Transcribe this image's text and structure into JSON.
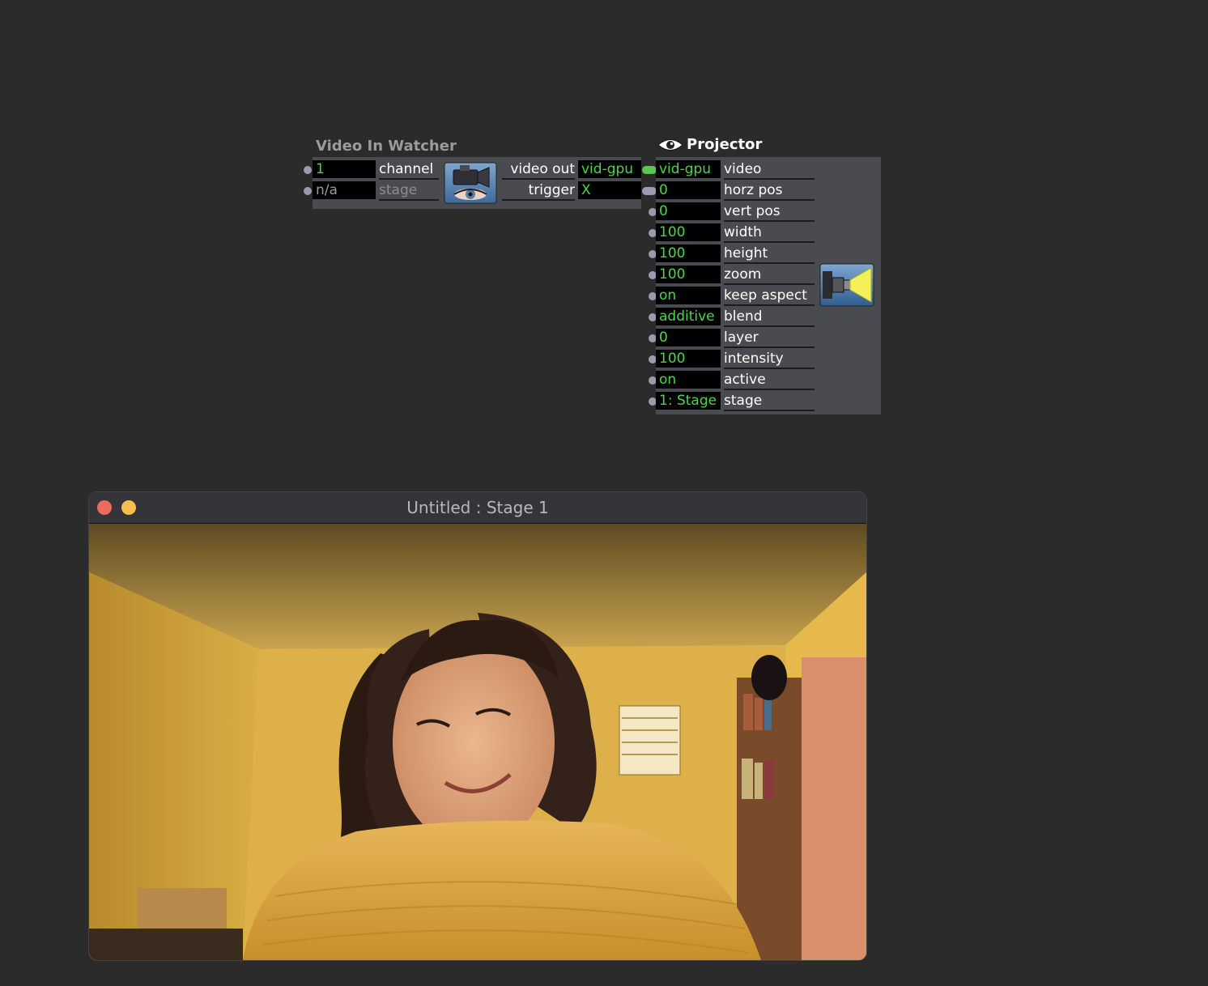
{
  "video_in_watcher": {
    "title": "Video In Watcher",
    "inputs": [
      {
        "value": "1",
        "label": "channel"
      },
      {
        "value": "n/a",
        "label": "stage"
      }
    ],
    "outputs": [
      {
        "label": "video out",
        "value": "vid-gpu"
      },
      {
        "label": "trigger",
        "value": "X"
      }
    ],
    "icon": "camera-eye-icon"
  },
  "projector": {
    "title": "Projector",
    "title_icon": "eye-icon",
    "icon": "projector-icon",
    "inputs": [
      {
        "value": "vid-gpu",
        "label": "video"
      },
      {
        "value": "0",
        "label": "horz pos"
      },
      {
        "value": "0",
        "label": "vert pos"
      },
      {
        "value": "100",
        "label": "width"
      },
      {
        "value": "100",
        "label": "height"
      },
      {
        "value": "100",
        "label": "zoom"
      },
      {
        "value": "on",
        "label": "keep aspect"
      },
      {
        "value": "additive",
        "label": "blend"
      },
      {
        "value": "0",
        "label": "layer"
      },
      {
        "value": "100",
        "label": "intensity"
      },
      {
        "value": "on",
        "label": "active"
      },
      {
        "value": "1: Stage",
        "label": "stage"
      }
    ]
  },
  "stage_window": {
    "title": "Untitled : Stage 1",
    "content": "live-camera-feed"
  },
  "colors": {
    "background": "#2b2b2c",
    "actor_body": "#4a4b50",
    "value_text": "#4fd349",
    "close": "#ed6a5e",
    "minimize": "#f5bf4f"
  }
}
